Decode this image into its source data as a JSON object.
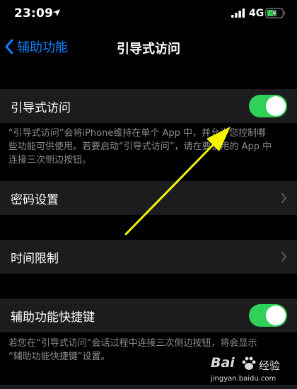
{
  "status_bar": {
    "time": "23:09",
    "network": "4G"
  },
  "nav": {
    "back_label": "辅助功能",
    "title": "引导式访问"
  },
  "guided_access": {
    "label": "引导式访问",
    "toggle_on": true,
    "description_lines": [
      "“引导式访问”会将iPhone维持在单个 App 中，并允许您控制哪",
      "些功能可供使用。若要启动“引导式访问”，请在要使用的 App 中",
      "连接三次侧边按钮。"
    ]
  },
  "passcode_settings": {
    "label": "密码设置"
  },
  "time_limits": {
    "label": "时间限制"
  },
  "accessibility_shortcut": {
    "label": "辅助功能快捷键",
    "toggle_on": true,
    "description_lines": [
      "若您在“引导式访问”会话过程中连接三次侧边按钮，将会显示",
      "“辅助功能快捷键”设置。"
    ]
  },
  "watermark": {
    "brand": "Bai",
    "name": "经验",
    "url": "jingyan.baidu.com"
  },
  "colors": {
    "background": "#000000",
    "cell": "#1c1c1e",
    "accent": "#0a84ff",
    "toggle_on": "#30d158",
    "secondary_text": "#8e8e93",
    "annotation_arrow": "#f5f500"
  },
  "icons": [
    "location-arrow-icon",
    "cellular-signal-icon",
    "battery-charging-icon",
    "chevron-left-icon",
    "chevron-right-icon",
    "baidu-paw-icon"
  ]
}
